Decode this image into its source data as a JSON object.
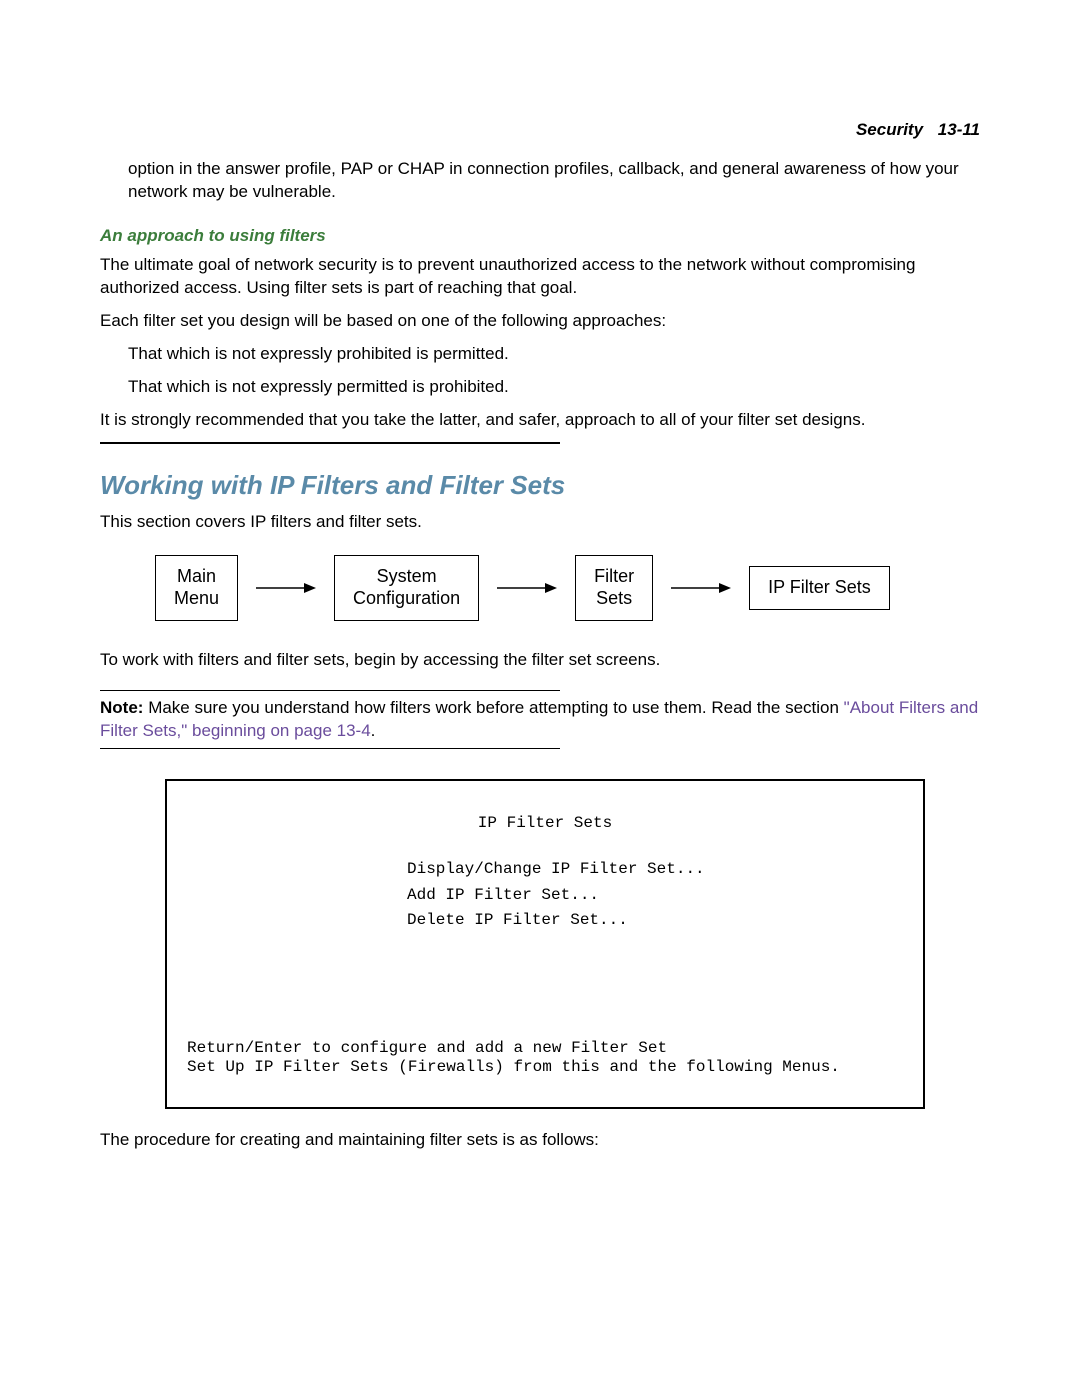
{
  "running_head": {
    "chapter": "Security",
    "page": "13-11"
  },
  "intro_continuation": "option in the answer profile, PAP or CHAP in connection profiles, callback, and general awareness of how your network may be vulnerable.",
  "subheading": "An approach to using filters",
  "para_goal": "The ultimate goal of network security is to prevent unauthorized access to the network without compromising authorized access. Using filter sets is part of reaching that goal.",
  "para_each": "Each filter set you design will be based on one of the following approaches:",
  "bullet_permitted": "That which is not expressly prohibited is permitted.",
  "bullet_prohibited": "That which is not expressly permitted is prohibited.",
  "para_recommend": "It is strongly recommended that you take the latter, and safer, approach to all of your filter set designs.",
  "section_heading": "Working with IP Filters and Filter Sets",
  "para_covers": "This section covers IP filters and filter sets.",
  "nav": {
    "box1_line1": "Main",
    "box1_line2": "Menu",
    "box2_line1": "System",
    "box2_line2": "Configuration",
    "box3_line1": "Filter",
    "box3_line2": "Sets",
    "box4": "IP Filter Sets"
  },
  "para_to_work": "To work with filters and filter sets, begin by accessing the filter set screens.",
  "note": {
    "label": "Note:",
    "text_before_link": "Make sure you understand how filters work before attempting to use them. Read the section ",
    "link_text": "\"About Filters and Filter Sets,\" beginning on page 13-4",
    "text_after_link": "."
  },
  "terminal": {
    "title": "IP Filter Sets",
    "menu": [
      "Display/Change IP Filter Set...",
      "Add IP Filter Set...",
      "Delete IP Filter Set..."
    ],
    "footer1": "Return/Enter to configure and add a new Filter Set",
    "footer2": "Set Up IP Filter Sets (Firewalls) from this and the following Menus."
  },
  "para_procedure": "The procedure for creating and maintaining filter sets is as follows:"
}
